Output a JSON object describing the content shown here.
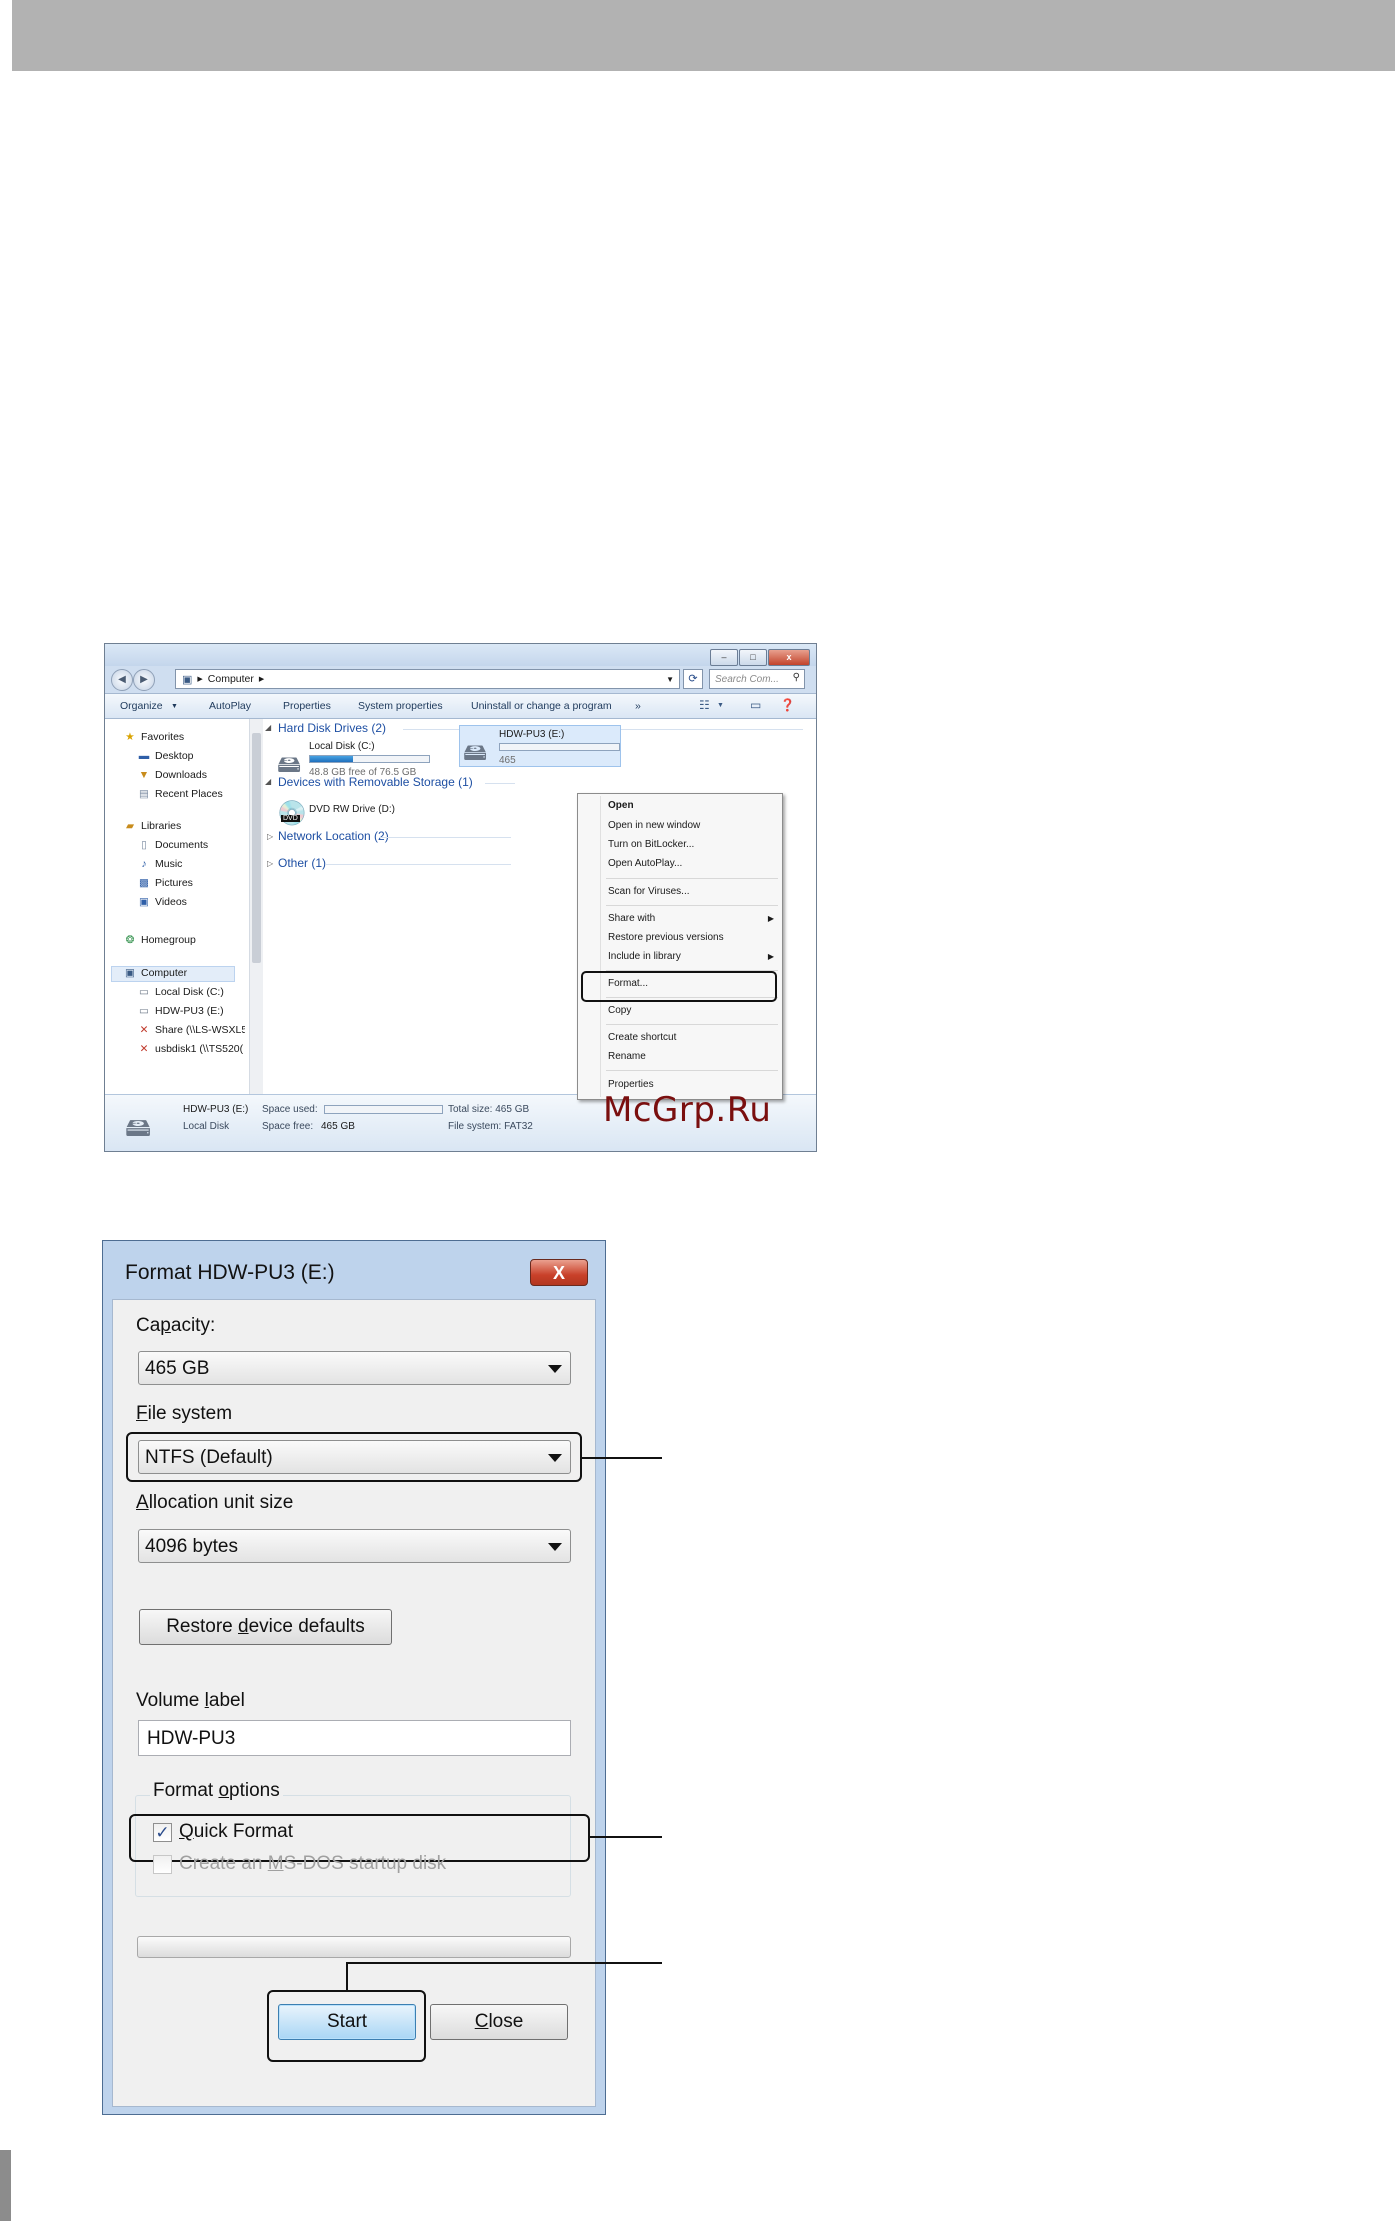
{
  "explorer": {
    "address_path": [
      "Computer"
    ],
    "search_placeholder": "Search Com...",
    "toolbar": [
      "Organize",
      "AutoPlay",
      "Properties",
      "System properties",
      "Uninstall or change a program"
    ],
    "more": "»",
    "nav": {
      "favorites": "Favorites",
      "favorites_items": [
        "Desktop",
        "Downloads",
        "Recent Places"
      ],
      "libraries": "Libraries",
      "libraries_items": [
        "Documents",
        "Music",
        "Pictures",
        "Videos"
      ],
      "homegroup": "Homegroup",
      "computer": "Computer",
      "computer_items": [
        "Local Disk (C:)",
        "HDW-PU3 (E:)",
        "Share (\\\\LS-WSXL5",
        "usbdisk1 (\\\\TS520("
      ]
    },
    "groups": {
      "hard_disks": "Hard Disk Drives (2)",
      "removable": "Devices with Removable Storage (1)",
      "network": "Network Location (2)",
      "other": "Other (1)"
    },
    "drives": {
      "c_name": "Local Disk (C:)",
      "c_free": "48.8 GB free of 76.5 GB",
      "c_used_fraction": 0.36,
      "e_name": "HDW-PU3 (E:)",
      "e_free": "465",
      "dvd_name": "DVD RW Drive (D:)",
      "dvd_badge": "DVD"
    },
    "context_menu": [
      "Open",
      "Open in new window",
      "Turn on BitLocker...",
      "Open AutoPlay...",
      "Scan for Viruses...",
      "Share with",
      "Restore previous versions",
      "Include in library",
      "Format...",
      "Copy",
      "Create shortcut",
      "Rename",
      "Properties"
    ],
    "details": {
      "name": "HDW-PU3 (E:)",
      "type": "Local Disk",
      "space_used_label": "Space used:",
      "space_free_label": "Space free:",
      "space_free_value": "465 GB",
      "total_size": "Total size: 465 GB",
      "file_system": "File system: FAT32"
    }
  },
  "watermark": "McGrp.Ru",
  "format_dialog": {
    "title": "Format HDW-PU3 (E:)",
    "close_glyph": "X",
    "capacity_label_pre": "Ca",
    "capacity_label_u": "p",
    "capacity_label_post": "acity:",
    "capacity_value": "465 GB",
    "fs_label_u": "F",
    "fs_label_post": "ile system",
    "fs_value": "NTFS (Default)",
    "alloc_label_u": "A",
    "alloc_label_post": "llocation unit size",
    "alloc_value": "4096 bytes",
    "restore_pre": "Restore ",
    "restore_u": "d",
    "restore_post": "evice defaults",
    "volume_label_pre": "Volume ",
    "volume_label_u": "l",
    "volume_label_post": "abel",
    "volume_value": "HDW-PU3",
    "options_pre": "Format ",
    "options_u": "o",
    "options_post": "ptions",
    "quick_u": "Q",
    "quick_post": "uick Format",
    "quick_checked": true,
    "msdos_pre": "Create an ",
    "msdos_u": "M",
    "msdos_post": "S-DOS startup disk",
    "start": "Start",
    "close_pre": "",
    "close_u": "C",
    "close_post": "lose"
  },
  "colors": {
    "header_band": "#b2b2b2",
    "link_blue": "#1e4fa3",
    "watermark": "#7a0f0f",
    "dialog_frame": "#bed3ec",
    "close_red": "#c9412a"
  }
}
